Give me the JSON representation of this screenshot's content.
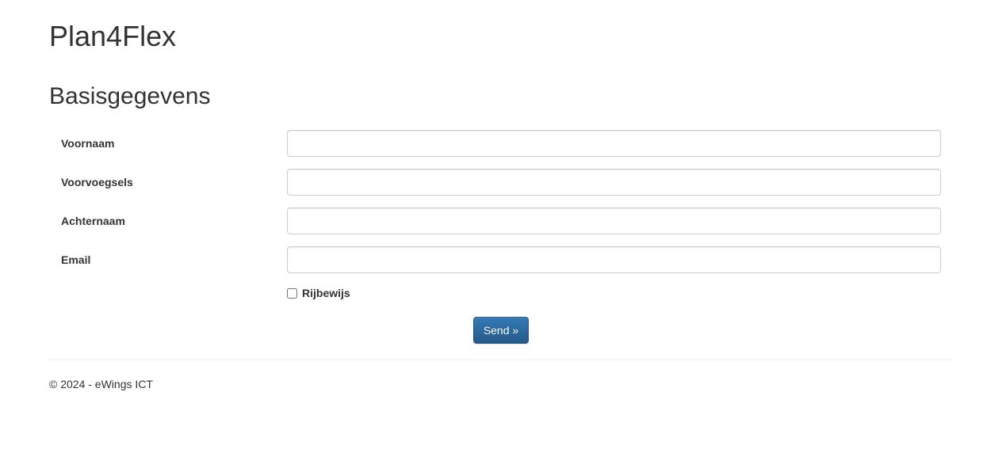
{
  "header": {
    "title": "Plan4Flex"
  },
  "page": {
    "heading": "Basisgegevens"
  },
  "form": {
    "voornaam": {
      "label": "Voornaam",
      "value": ""
    },
    "voorvoegsels": {
      "label": "Voorvoegsels",
      "value": ""
    },
    "achternaam": {
      "label": "Achternaam",
      "value": ""
    },
    "email": {
      "label": "Email",
      "value": ""
    },
    "rijbewijs": {
      "label": "Rijbewijs",
      "checked": false
    },
    "submit": {
      "label": "Send »"
    }
  },
  "footer": {
    "text": "© 2024 - eWings ICT"
  }
}
